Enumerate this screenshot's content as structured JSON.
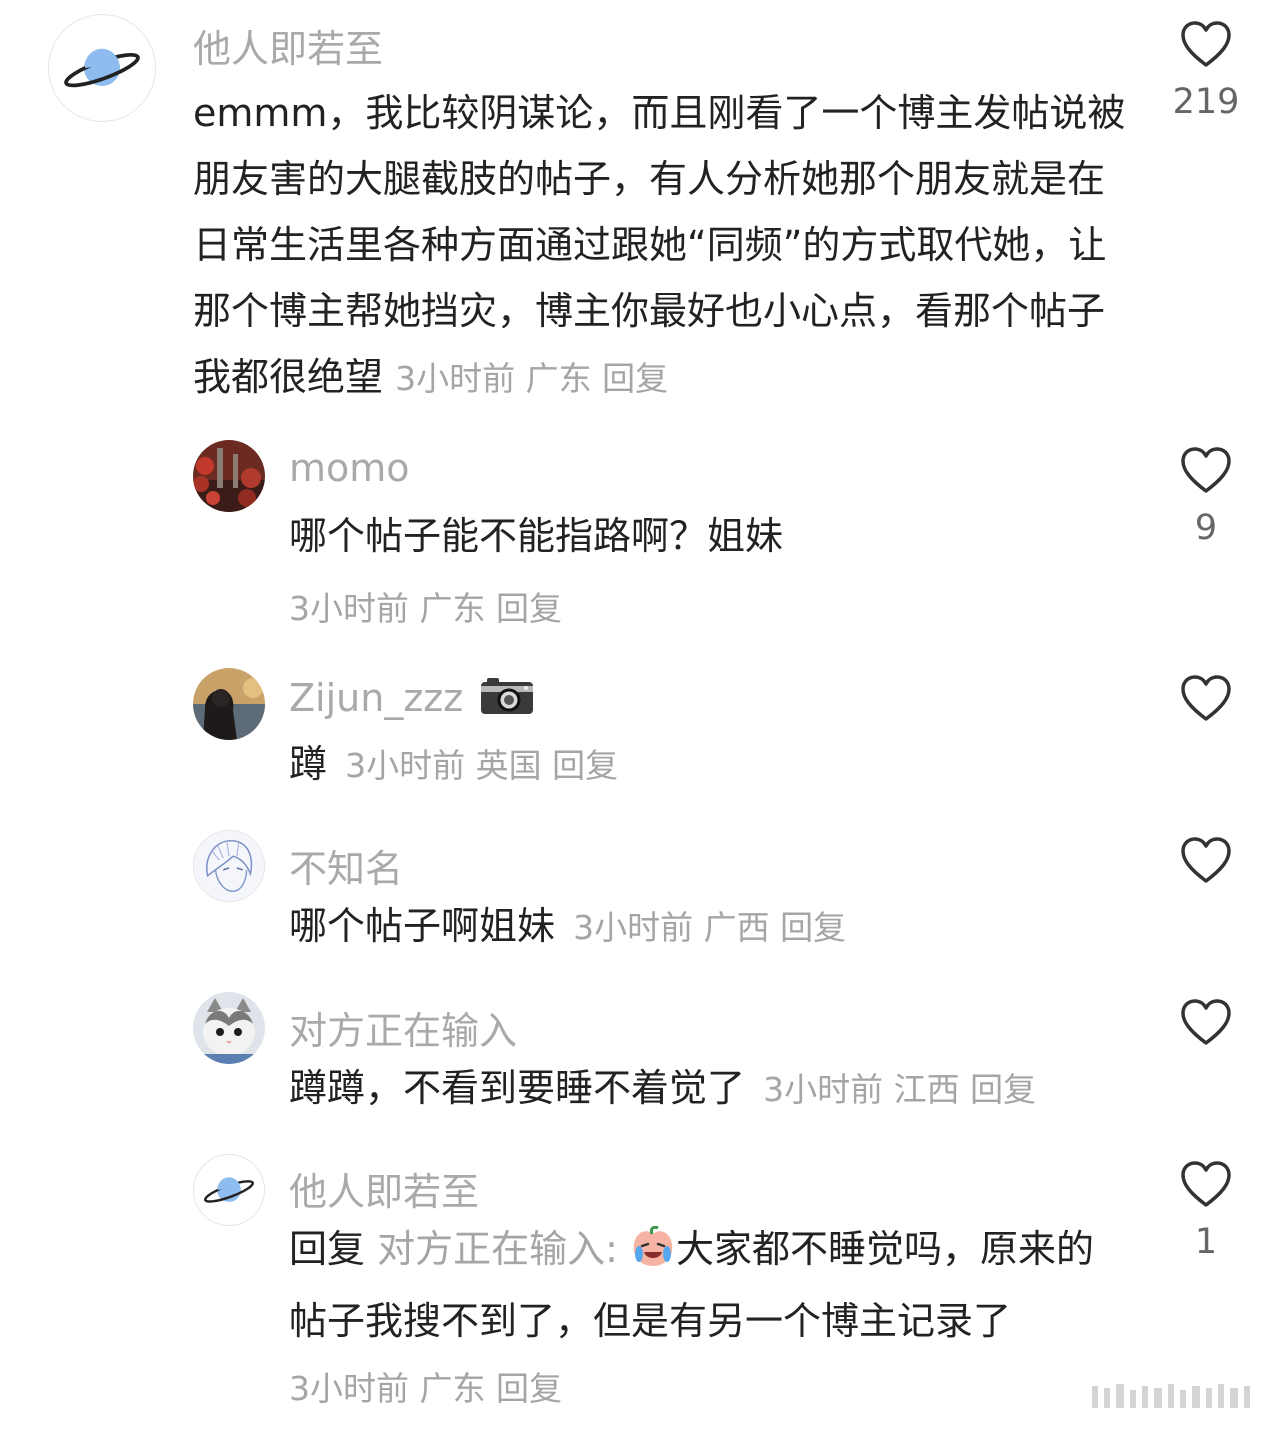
{
  "comments": [
    {
      "username": "他人即若至",
      "avatar_icon": "saturn-planet-icon",
      "text": "emmm，我比较阴谋论，而且刚看了一个博主发帖说被朋友害的大腿截肢的帖子，有人分析她那个朋友就是在日常生活里各种方面通过跟她“同频”的方式取代她，让那个博主帮她挡灾，博主你最好也小心点，看那个帖子我都很绝望",
      "time": "3小时前",
      "location": "广东",
      "reply_label": "回复",
      "like_count": "219"
    },
    {
      "username": "momo",
      "avatar_icon": "red-flowers-chimney-photo",
      "text": "哪个帖子能不能指路啊？姐妹",
      "time": "3小时前",
      "location": "广东",
      "reply_label": "回复",
      "like_count": "9"
    },
    {
      "username": "Zijun_zzz",
      "username_emoji": "camera-icon",
      "avatar_icon": "woman-by-water-photo",
      "text": "蹲",
      "time": "3小时前",
      "location": "英国",
      "reply_label": "回复",
      "like_count": ""
    },
    {
      "username": "不知名",
      "avatar_icon": "anime-sketch-portrait",
      "text": "哪个帖子啊姐妹",
      "time": "3小时前",
      "location": "广西",
      "reply_label": "回复",
      "like_count": ""
    },
    {
      "username": "对方正在输入",
      "avatar_icon": "kitten-photo",
      "text": "蹲蹲，不看到要睡不着觉了",
      "time": "3小时前",
      "location": "江西",
      "reply_label": "回复",
      "like_count": ""
    },
    {
      "username": "他人即若至",
      "avatar_icon": "saturn-planet-icon",
      "reply_prefix": "回复",
      "reply_to": "对方正在输入",
      "reply_colon": ":",
      "reply_emoji": "crying-laughing-peach-emoji",
      "text": "大家都不睡觉吗，原来的帖子我搜不到了，但是有另一个博主记录了",
      "time": "3小时前",
      "location": "广东",
      "reply_label": "回复",
      "like_count": "1"
    }
  ],
  "colors": {
    "text": "#222222",
    "meta": "#a5a5a5",
    "username": "#a9a9a9",
    "heart_outline": "#333333",
    "planet_blue": "#8fbcee"
  }
}
